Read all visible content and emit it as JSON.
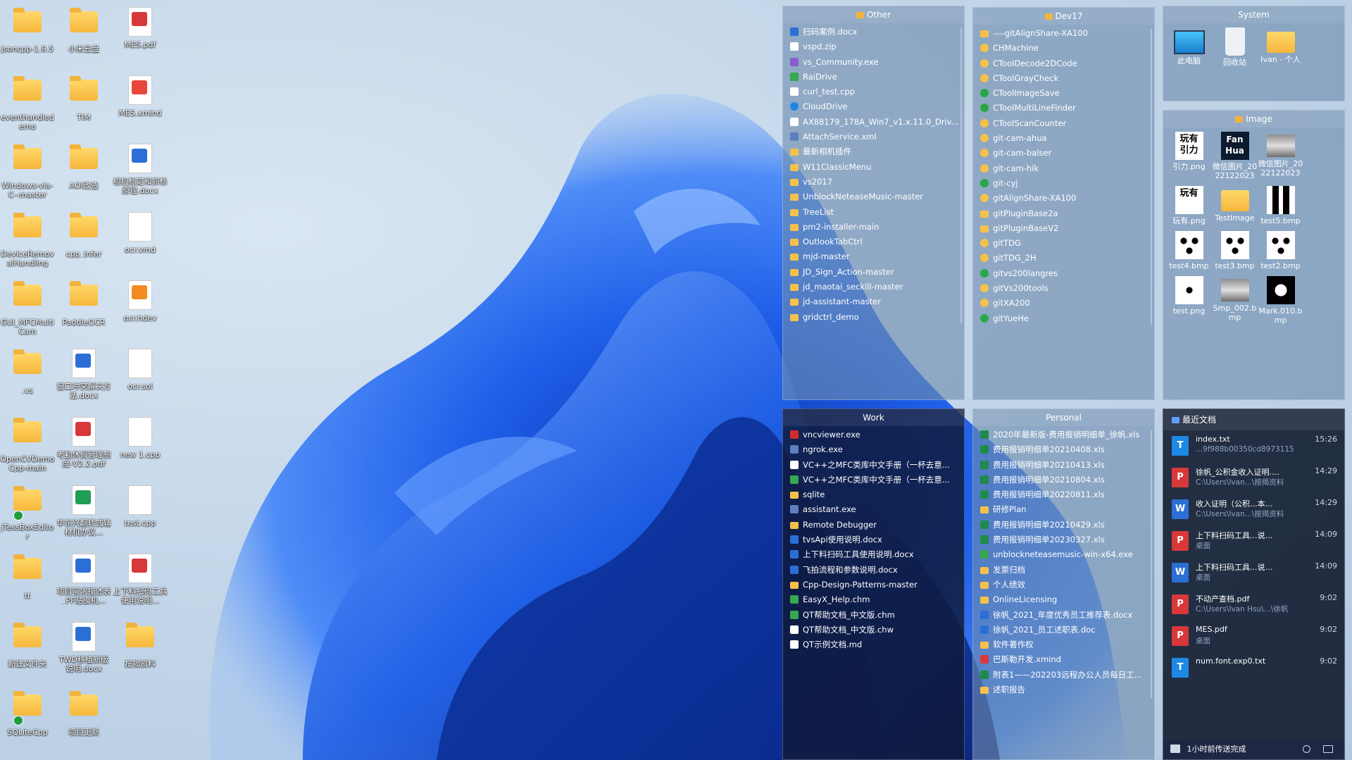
{
  "desktop_icons": [
    {
      "label": "jsoncpp-1.9.5",
      "type": "folder"
    },
    {
      "label": "小米云盘",
      "type": "folder"
    },
    {
      "label": "MES.pdf",
      "type": "pdf"
    },
    {
      "label": "eventhandledemo",
      "type": "folder"
    },
    {
      "label": "TIM",
      "type": "folder"
    },
    {
      "label": "MES.xmind",
      "type": "xmind"
    },
    {
      "label": "Windows-via-C--master",
      "type": "folder"
    },
    {
      "label": "AOI改造",
      "type": "folder"
    },
    {
      "label": "相机标定和抓标原理.docx",
      "type": "docx"
    },
    {
      "label": "DeviceRemovalHandling",
      "type": "folder"
    },
    {
      "label": "cpp_infer",
      "type": "folder"
    },
    {
      "label": "ocr.vmd",
      "type": "file"
    },
    {
      "label": "GUI_MFCMultiCam",
      "type": "folder"
    },
    {
      "label": "PaddleOCR",
      "type": "folder"
    },
    {
      "label": "ocr.hdev",
      "type": "hdev"
    },
    {
      "label": ".vs",
      "type": "folder"
    },
    {
      "label": "窗口冲突解决方法.docx",
      "type": "docx"
    },
    {
      "label": "ocr.sol",
      "type": "file"
    },
    {
      "label": "OpenCVDemoCpp-main",
      "type": "folder"
    },
    {
      "label": "考勤休假管理制度-V2.2.pdf",
      "type": "pdf"
    },
    {
      "label": "new 1.cpp",
      "type": "file"
    },
    {
      "label": "jTessBoxEditor",
      "type": "folder-ok"
    },
    {
      "label": "华东兴翻转式辅材机办议...",
      "type": "xls"
    },
    {
      "label": "test.cpp",
      "type": "file"
    },
    {
      "label": "tt",
      "type": "folder"
    },
    {
      "label": "项目需求描述表_PF贴膜机...",
      "type": "docx"
    },
    {
      "label": "上下料扫码工具使用说明...",
      "type": "pdf"
    },
    {
      "label": "新建文件夹",
      "type": "folder"
    },
    {
      "label": "TWD移植新版说明.docx",
      "type": "docx"
    },
    {
      "label": "按揭资料",
      "type": "folder"
    },
    {
      "label": "SQLiteCpp",
      "type": "folder-ok"
    },
    {
      "label": "项目更新",
      "type": "folder"
    }
  ],
  "fences": {
    "other": {
      "title": "Other",
      "items": [
        {
          "label": "扫码案例.docx",
          "icon": "docx"
        },
        {
          "label": "vspd.zip",
          "icon": "file"
        },
        {
          "label": "vs_Community.exe",
          "icon": "purple"
        },
        {
          "label": "RaiDrive",
          "icon": "green"
        },
        {
          "label": "curl_test.cpp",
          "icon": "file"
        },
        {
          "label": "CloudDrive",
          "icon": "blue"
        },
        {
          "label": "AX88179_178A_Win7_v1.x.11.0_Driv...",
          "icon": "file"
        },
        {
          "label": "AttachService.xml",
          "icon": "exe"
        },
        {
          "label": "最新相机插件",
          "icon": "folder"
        },
        {
          "label": "W11ClassicMenu",
          "icon": "folder"
        },
        {
          "label": "vs2017",
          "icon": "folder"
        },
        {
          "label": "UnblockNeteaseMusic-master",
          "icon": "folder"
        },
        {
          "label": "TreeList",
          "icon": "folder"
        },
        {
          "label": "pm2-installer-main",
          "icon": "folder"
        },
        {
          "label": "OutlookTabCtrl",
          "icon": "folder"
        },
        {
          "label": "mjd-master",
          "icon": "folder"
        },
        {
          "label": "JD_Sign_Action-master",
          "icon": "folder"
        },
        {
          "label": "jd_maotai_seckill-master",
          "icon": "folder"
        },
        {
          "label": "jd-assistant-master",
          "icon": "folder"
        },
        {
          "label": "gridctrl_demo",
          "icon": "folder"
        }
      ]
    },
    "dev17": {
      "title": "Dev17",
      "items": [
        {
          "label": "----gitAlignShare-XA100",
          "icon": "folder"
        },
        {
          "label": "CHMachine",
          "icon": "git"
        },
        {
          "label": "CToolDecode2DCode",
          "icon": "git"
        },
        {
          "label": "CToolGrayCheck",
          "icon": "git"
        },
        {
          "label": "CToolImageSave",
          "icon": "gitok"
        },
        {
          "label": "CToolMultiLineFinder",
          "icon": "gitok"
        },
        {
          "label": "CToolScanCounter",
          "icon": "git"
        },
        {
          "label": "git-cam-ahua",
          "icon": "git"
        },
        {
          "label": "git-cam-balser",
          "icon": "git"
        },
        {
          "label": "git-cam-hik",
          "icon": "git"
        },
        {
          "label": "git-cyj",
          "icon": "gitok"
        },
        {
          "label": "gitAlignShare-XA100",
          "icon": "git"
        },
        {
          "label": "gitPluginBase2a",
          "icon": "folder"
        },
        {
          "label": "gitPluginBaseV2",
          "icon": "folder"
        },
        {
          "label": "gitTDG",
          "icon": "git"
        },
        {
          "label": "gitTDG_2H",
          "icon": "git"
        },
        {
          "label": "gitvs200langres",
          "icon": "gitok"
        },
        {
          "label": "gitVs200tools",
          "icon": "git"
        },
        {
          "label": "gitXA200",
          "icon": "git"
        },
        {
          "label": "gitYueHe",
          "icon": "gitok"
        }
      ]
    },
    "system": {
      "title": "System",
      "items": [
        {
          "label": "此电脑",
          "icon": "monitor"
        },
        {
          "label": "回收站",
          "icon": "recycle"
        },
        {
          "label": "Ivan - 个人",
          "icon": "folder"
        }
      ]
    },
    "image": {
      "title": "Image",
      "items": [
        {
          "label": "引力.png",
          "icon": "text-img",
          "glyph": "玩有\n引力"
        },
        {
          "label": "微信图片_20221220233...",
          "icon": "dark-img",
          "glyph": "Fan\nHua"
        },
        {
          "label": "微信图片_20221220230...",
          "icon": "photo"
        },
        {
          "label": "玩有.png",
          "icon": "text-img",
          "glyph": "玩有"
        },
        {
          "label": "TestImage",
          "icon": "folder"
        },
        {
          "label": "test5.bmp",
          "icon": "bars"
        },
        {
          "label": "test4.bmp",
          "icon": "dots"
        },
        {
          "label": "test3.bmp",
          "icon": "dots"
        },
        {
          "label": "test2.bmp",
          "icon": "dots"
        },
        {
          "label": "test.png",
          "icon": "dot"
        },
        {
          "label": "Smp_002.bmp",
          "icon": "photo"
        },
        {
          "label": "Mark.010.bmp",
          "icon": "mark"
        }
      ]
    },
    "work": {
      "title": "Work",
      "items": [
        {
          "label": "vncviewer.exe",
          "icon": "vnc"
        },
        {
          "label": "ngrok.exe",
          "icon": "exe"
        },
        {
          "label": "VC++之MFC类库中文手册（一杯去意...",
          "icon": "file"
        },
        {
          "label": "VC++之MFC类库中文手册（一杯去意...",
          "icon": "green"
        },
        {
          "label": "sqlite",
          "icon": "folder"
        },
        {
          "label": "assistant.exe",
          "icon": "exe"
        },
        {
          "label": "Remote Debugger",
          "icon": "folder"
        },
        {
          "label": "tvsApi使用说明.docx",
          "icon": "docx"
        },
        {
          "label": "上下料扫码工具使用说明.docx",
          "icon": "docx"
        },
        {
          "label": "飞拍流程和参数说明.docx",
          "icon": "docx"
        },
        {
          "label": "Cpp-Design-Patterns-master",
          "icon": "folder"
        },
        {
          "label": "EasyX_Help.chm",
          "icon": "green"
        },
        {
          "label": "QT帮助文档_中文版.chm",
          "icon": "green"
        },
        {
          "label": "QT帮助文档_中文版.chw",
          "icon": "file"
        },
        {
          "label": "QT示例文档.md",
          "icon": "file"
        }
      ]
    },
    "personal": {
      "title": "Personal",
      "items": [
        {
          "label": "2020年最新版-费用报销明细单_徐帆.xls",
          "icon": "xls"
        },
        {
          "label": "费用报销明细单20210408.xls",
          "icon": "xls"
        },
        {
          "label": "费用报销明细单20210413.xls",
          "icon": "xls"
        },
        {
          "label": "费用报销明细单20210804.xls",
          "icon": "xls"
        },
        {
          "label": "费用报销明细单20220811.xls",
          "icon": "xls"
        },
        {
          "label": "研修Plan",
          "icon": "folder"
        },
        {
          "label": "费用报销明细单20210429.xls",
          "icon": "xls"
        },
        {
          "label": "费用报销明细单20230327.xls",
          "icon": "xls"
        },
        {
          "label": "unblockneteasemusic-win-x64.exe",
          "icon": "green"
        },
        {
          "label": "发票归档",
          "icon": "folder"
        },
        {
          "label": "个人绩效",
          "icon": "folder"
        },
        {
          "label": "OnlineLicensing",
          "icon": "folder"
        },
        {
          "label": "徐帆_2021_年度优秀员工推荐表.docx",
          "icon": "docx"
        },
        {
          "label": "徐帆_2021_员工述职表.doc",
          "icon": "docx"
        },
        {
          "label": "软件著作权",
          "icon": "folder"
        },
        {
          "label": "巴斯勒开发.xmind",
          "icon": "pdf"
        },
        {
          "label": "附表1——202203远程办公人员每日工...",
          "icon": "xls"
        },
        {
          "label": "述职报告",
          "icon": "folder"
        }
      ]
    },
    "recent": {
      "title": "最近文档",
      "items": [
        {
          "name": "index.txt",
          "path": "...9f988b00350cd8973115",
          "time": "15:26",
          "icon": "T",
          "color": "#1e88e5"
        },
        {
          "name": "徐帆_公积金收入证明.pdf",
          "path": "C:\\Users\\Ivan...\\按揭资料",
          "time": "14:29",
          "icon": "P",
          "color": "#d8383a"
        },
        {
          "name": "收入证明（公积...本）.doc",
          "path": "C:\\Users\\Ivan...\\按揭资料",
          "time": "14:29",
          "icon": "W",
          "color": "#2b6fd6"
        },
        {
          "name": "上下料扫码工具...说明.pdf",
          "path": "桌面",
          "time": "14:09",
          "icon": "P",
          "color": "#d8383a"
        },
        {
          "name": "上下料扫码工具...说明.docx",
          "path": "桌面",
          "time": "14:09",
          "icon": "W",
          "color": "#2b6fd6"
        },
        {
          "name": "不动产查档.pdf",
          "path": "C:\\Users\\Ivan Hsu\\...\\徐帆",
          "time": "9:02",
          "icon": "P",
          "color": "#d8383a"
        },
        {
          "name": "MES.pdf",
          "path": "桌面",
          "time": "9:02",
          "icon": "P",
          "color": "#d8383a"
        },
        {
          "name": "num.font.exp0.txt",
          "path": "",
          "time": "9:02",
          "icon": "T",
          "color": "#1e88e5"
        }
      ],
      "footer": "1小时前传送完成"
    }
  }
}
